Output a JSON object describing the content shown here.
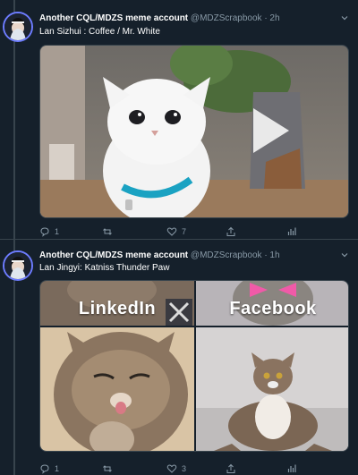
{
  "tweets": [
    {
      "name": "Another CQL/MDZS meme account",
      "handle": "@MDZScrapbook",
      "time": "· 2h",
      "text": "Lan Sizhui : Coffee / Mr. White",
      "replies": "1",
      "retweets": "",
      "likes": "7",
      "image_alt": "white cat with blue collar"
    },
    {
      "name": "Another CQL/MDZS meme account",
      "handle": "@MDZScrapbook",
      "time": "· 1h",
      "text": "Lan Jingyi: Katniss Thunder Paw",
      "replies": "1",
      "retweets": "",
      "likes": "3",
      "grid_labels": [
        "LinkedIn",
        "Facebook"
      ]
    }
  ],
  "icons": [
    "avatar",
    "chevron-down-icon",
    "reply-icon",
    "retweet-icon",
    "like-icon",
    "share-icon",
    "analytics-icon"
  ]
}
